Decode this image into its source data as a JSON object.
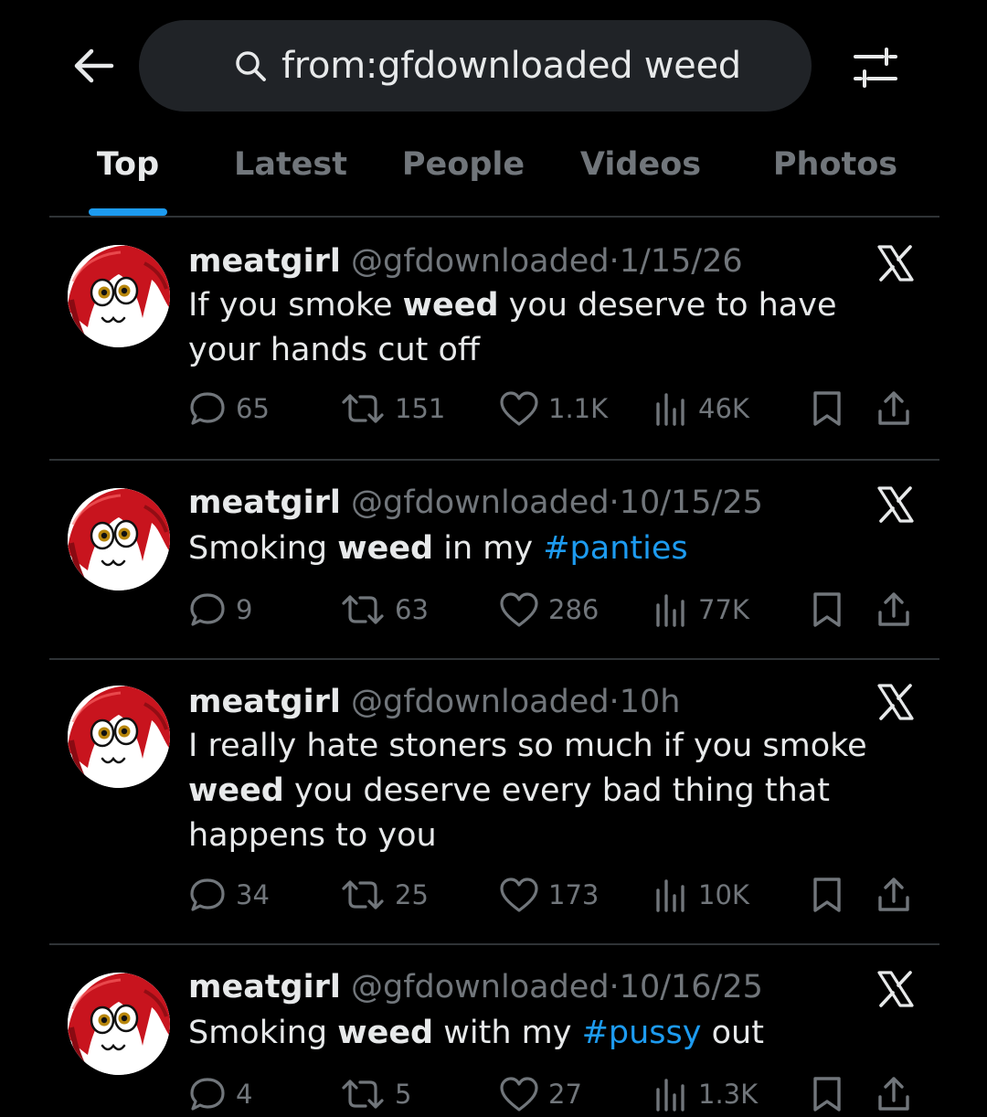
{
  "search": {
    "query": "from:gfdownloaded weed"
  },
  "tabs": [
    "Top",
    "Latest",
    "People",
    "Videos",
    "Photos"
  ],
  "tweets": [
    {
      "name": "meatgirl",
      "handle": "@gfdownloaded",
      "dot": "·",
      "time": "1/15/26",
      "text": [
        "If you smoke ",
        "weed",
        " you deserve to have your hands cut off"
      ],
      "replies": "65",
      "reposts": "151",
      "likes": "1.1K",
      "views": "46K"
    },
    {
      "name": "meatgirl",
      "handle": "@gfdownloaded",
      "dot": "·",
      "time": "10/15/25",
      "text": [
        "Smoking ",
        "weed",
        " in my ",
        "#panties"
      ],
      "replies": "9",
      "reposts": "63",
      "likes": "286",
      "views": "77K"
    },
    {
      "name": "meatgirl",
      "handle": "@gfdownloaded",
      "dot": "·",
      "time": "10h",
      "text": [
        "I really hate stoners so much if you smoke ",
        "weed",
        " you deserve every bad thing that happens to you"
      ],
      "replies": "34",
      "reposts": "25",
      "likes": "173",
      "views": "10K"
    },
    {
      "name": "meatgirl",
      "handle": "@gfdownloaded",
      "dot": "·",
      "time": "10/16/25",
      "text": [
        "Smoking ",
        "weed",
        " with my ",
        "#pussy",
        " out"
      ],
      "replies": "4",
      "reposts": "5",
      "likes": "27",
      "views": "1.3K"
    }
  ],
  "icons": {
    "back": "arrow-left-icon",
    "search": "search-icon",
    "filter": "sliders-icon",
    "more": "x-logo-icon",
    "reply": "reply-icon",
    "repost": "repost-icon",
    "like": "heart-icon",
    "views": "views-icon",
    "bookmark": "bookmark-icon",
    "share": "share-icon"
  },
  "colors": {
    "background": "#000000",
    "accent": "#1d9bf0",
    "muted": "#71767b",
    "text": "#e7e9ea"
  }
}
